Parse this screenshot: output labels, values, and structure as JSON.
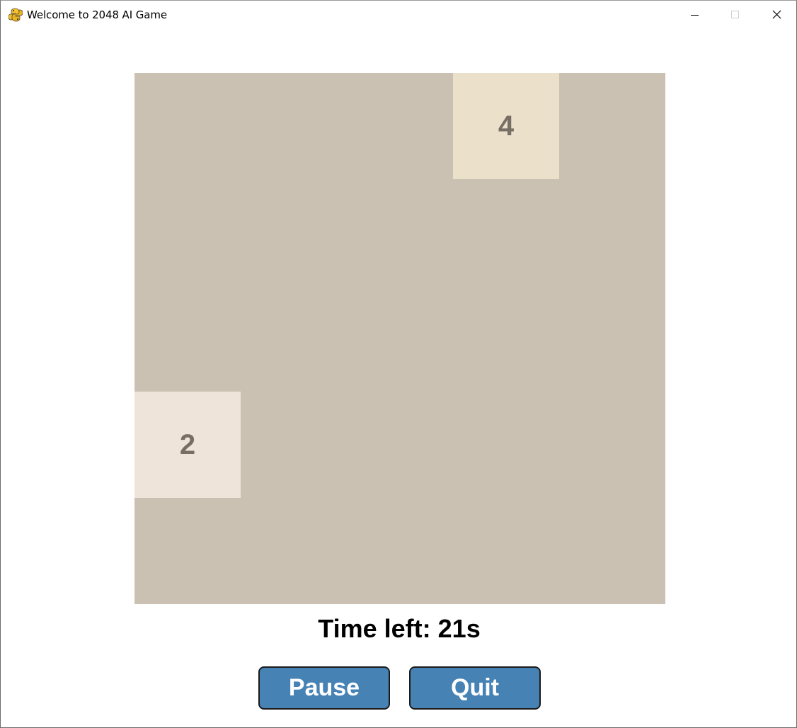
{
  "window": {
    "title": "Welcome to 2048 AI Game",
    "app_icon": "python-snake-icon",
    "controls": {
      "minimize_icon": "minimize-icon",
      "maximize_icon": "maximize-icon",
      "close_icon": "close-icon"
    }
  },
  "board": {
    "size": 5,
    "background_color": "#cbc1b3",
    "tiles": [
      {
        "value": "4",
        "row": 0,
        "col": 3,
        "color": "#ebe0ca",
        "text_color": "#776e65"
      },
      {
        "value": "2",
        "row": 3,
        "col": 0,
        "color": "#eee4da",
        "text_color": "#776e65"
      }
    ]
  },
  "status": {
    "timer_text": "Time left: 21s"
  },
  "buttons": {
    "pause_label": "Pause",
    "quit_label": "Quit",
    "color": "#4682b4"
  }
}
